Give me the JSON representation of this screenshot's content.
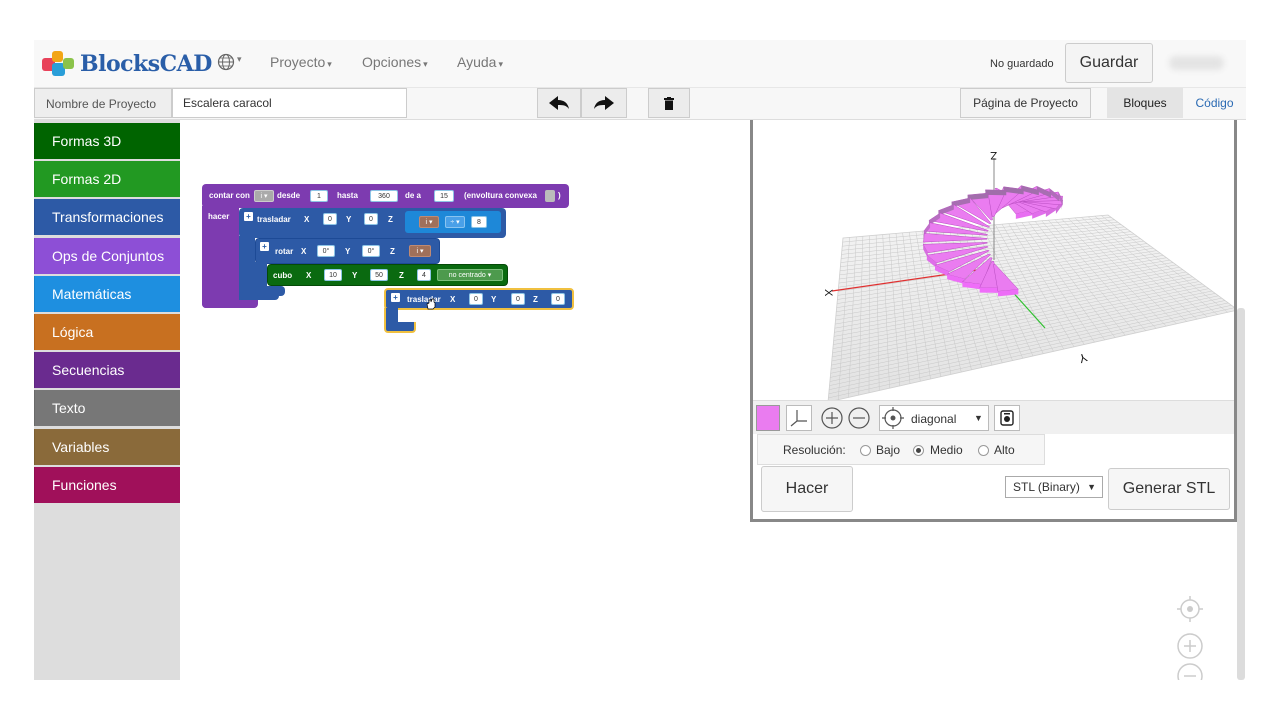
{
  "nav": {
    "brand": "BlocksCAD",
    "menus": [
      "Proyecto",
      "Opciones",
      "Ayuda"
    ],
    "status": "No guardado",
    "save_label": "Guardar"
  },
  "toolbar": {
    "project_label": "Nombre de Proyecto",
    "project_name": "Escalera caracol",
    "page_button": "Página de Proyecto",
    "tabs": [
      "Bloques",
      "Código"
    ]
  },
  "sidebar": {
    "categories": [
      {
        "label": "Formas 3D",
        "color": "#006400"
      },
      {
        "label": "Formas 2D",
        "color": "#229922"
      },
      {
        "label": "Transformaciones",
        "color": "#2d5aa6"
      },
      {
        "label": "Ops de Conjuntos",
        "color": "#8d4fd6"
      },
      {
        "label": "Matemáticas",
        "color": "#1e8fe0"
      },
      {
        "label": "Lógica",
        "color": "#c87020"
      },
      {
        "label": "Secuencias",
        "color": "#6a2b8f"
      },
      {
        "label": "Texto",
        "color": "#777777"
      },
      {
        "label": "Variables",
        "color": "#8a6a3a"
      },
      {
        "label": "Funciones",
        "color": "#a0105a"
      }
    ]
  },
  "blocks": {
    "loop": {
      "contar": "contar con",
      "var": "i ▾",
      "desde": "desde",
      "from": "1",
      "hasta": "hasta",
      "to": "360",
      "de_a": "de a",
      "step": "15",
      "hull": "(envoltura convexa",
      "close": ")",
      "hacer": "hacer"
    },
    "translate1": {
      "label": "trasladar",
      "x_label": "X",
      "x": "0",
      "y_label": "Y",
      "y": "0",
      "z_label": "Z",
      "var": "i ▾",
      "op": "÷ ▾",
      "div": "8"
    },
    "rotate": {
      "label": "rotar",
      "x_label": "X",
      "x": "0°",
      "y_label": "Y",
      "y": "0°",
      "z_label": "Z",
      "var": "i ▾"
    },
    "cube": {
      "label": "cubo",
      "x_label": "X",
      "x": "10",
      "y_label": "Y",
      "y": "50",
      "z_label": "Z",
      "z": "4",
      "center": "no centrado ▾"
    },
    "translate2": {
      "label": "trasladar",
      "x_label": "X",
      "x": "0",
      "y_label": "Y",
      "y": "0",
      "z_label": "Z",
      "z": "0"
    }
  },
  "viewer": {
    "axis_z": "Z",
    "axis_x": "X",
    "axis_y": "Y",
    "view_mode": "diagonal",
    "resolution_label": "Resolución:",
    "resolution_options": [
      "Bajo",
      "Medio",
      "Alto"
    ],
    "resolution_selected": "Medio",
    "render_button": "Hacer",
    "format": "STL (Binary)",
    "generate_button": "Generar STL",
    "model_color": "#ea7cf0"
  }
}
